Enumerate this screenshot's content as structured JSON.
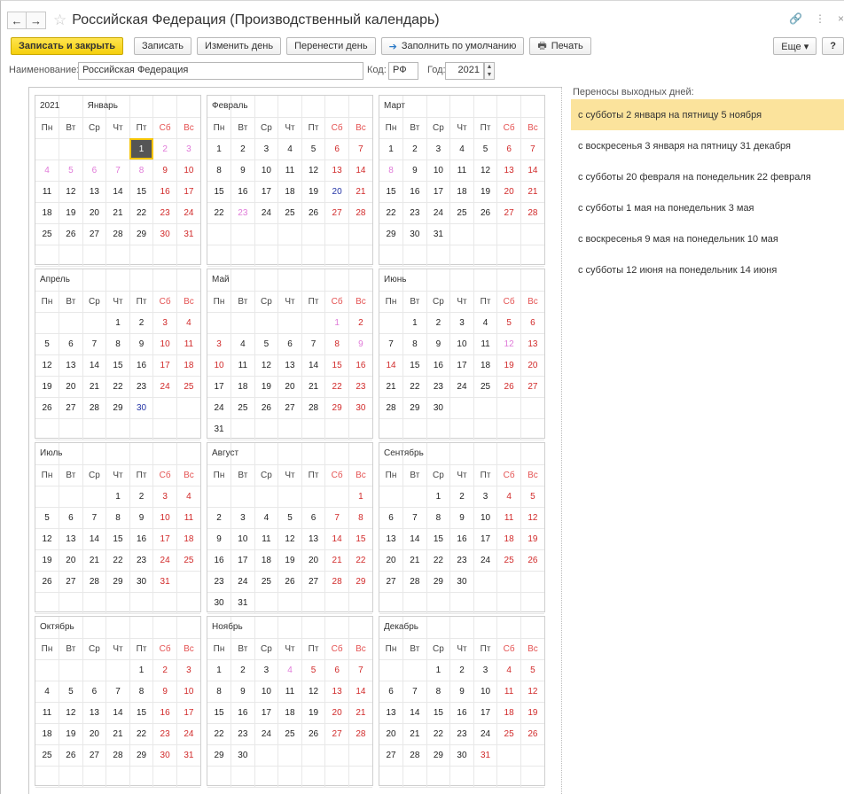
{
  "window": {
    "title": "Российская Федерация (Производственный календарь)",
    "back_label": "←",
    "forward_label": "→",
    "star_label": "☆",
    "link_label": "🔗",
    "menu_label": "⋮",
    "close_label": "×"
  },
  "toolbar": {
    "save_close": "Записать и закрыть",
    "save": "Записать",
    "change_day": "Изменить день",
    "move_day": "Перенести день",
    "fill_default": "Заполнить по умолчанию",
    "print": "Печать",
    "more": "Еще ▾",
    "help": "?"
  },
  "form": {
    "name_label": "Наименование:",
    "name_value": "Российская Федерация",
    "code_label": "Код:",
    "code_value": "РФ",
    "year_label": "Год:",
    "year_value": "2021"
  },
  "calendar": {
    "year": "2021",
    "weekdays": [
      "Пн",
      "Вт",
      "Ср",
      "Чт",
      "Пт",
      "Сб",
      "Вс"
    ],
    "months": [
      {
        "name": "Январь",
        "offset": 4,
        "days": 31,
        "red": [
          2,
          3,
          9,
          10,
          16,
          17,
          23,
          24,
          30,
          31
        ],
        "pink": [
          2,
          3,
          4,
          5,
          6,
          7,
          8
        ],
        "blue": [],
        "selected": 1,
        "redcore": [
          9,
          10,
          16,
          17,
          23,
          24,
          30,
          31
        ]
      },
      {
        "name": "Февраль",
        "offset": 0,
        "days": 28,
        "red": [
          6,
          7,
          13,
          14,
          21,
          27,
          28
        ],
        "pink": [
          23
        ],
        "blue": [
          20
        ]
      },
      {
        "name": "Март",
        "offset": 0,
        "days": 31,
        "red": [
          6,
          7,
          13,
          14,
          20,
          21,
          27,
          28
        ],
        "pink": [
          8
        ],
        "blue": []
      },
      {
        "name": "Апрель",
        "offset": 3,
        "days": 30,
        "red": [
          3,
          4,
          10,
          11,
          17,
          18,
          24,
          25
        ],
        "pink": [],
        "blue": [
          30
        ]
      },
      {
        "name": "Май",
        "offset": 5,
        "days": 31,
        "red": [
          2,
          3,
          8,
          10,
          15,
          16,
          22,
          23,
          29,
          30
        ],
        "pink": [
          1,
          9
        ],
        "blue": []
      },
      {
        "name": "Июнь",
        "offset": 1,
        "days": 30,
        "red": [
          5,
          6,
          13,
          14,
          19,
          20,
          26,
          27
        ],
        "pink": [
          12
        ],
        "blue": []
      },
      {
        "name": "Июль",
        "offset": 3,
        "days": 31,
        "red": [
          3,
          4,
          10,
          11,
          17,
          18,
          24,
          25,
          31
        ],
        "pink": [],
        "blue": []
      },
      {
        "name": "Август",
        "offset": 6,
        "days": 31,
        "red": [
          1,
          7,
          8,
          14,
          15,
          21,
          22,
          28,
          29
        ],
        "pink": [],
        "blue": []
      },
      {
        "name": "Сентябрь",
        "offset": 2,
        "days": 30,
        "red": [
          4,
          5,
          11,
          12,
          18,
          19,
          25,
          26
        ],
        "pink": [],
        "blue": []
      },
      {
        "name": "Октябрь",
        "offset": 4,
        "days": 31,
        "red": [
          2,
          3,
          9,
          10,
          16,
          17,
          23,
          24,
          30,
          31
        ],
        "pink": [],
        "blue": []
      },
      {
        "name": "Ноябрь",
        "offset": 0,
        "days": 30,
        "red": [
          5,
          6,
          7,
          13,
          14,
          20,
          21,
          27,
          28
        ],
        "pink": [
          4
        ],
        "blue": []
      },
      {
        "name": "Декабрь",
        "offset": 2,
        "days": 31,
        "red": [
          4,
          5,
          11,
          12,
          18,
          19,
          25,
          26,
          31
        ],
        "pink": [],
        "blue": []
      }
    ]
  },
  "transfers": {
    "label": "Переносы выходных дней:",
    "items": [
      "с субботы 2 января на пятницу 5 ноября",
      "с воскресенья 3 января на пятницу 31 декабря",
      "с субботы 20 февраля на понедельник 22 февраля",
      "с субботы 1 мая на понедельник 3 мая",
      "с воскресенья 9 мая на понедельник 10 мая",
      "с субботы 12 июня на понедельник 14 июня"
    ],
    "selected_index": 0
  }
}
